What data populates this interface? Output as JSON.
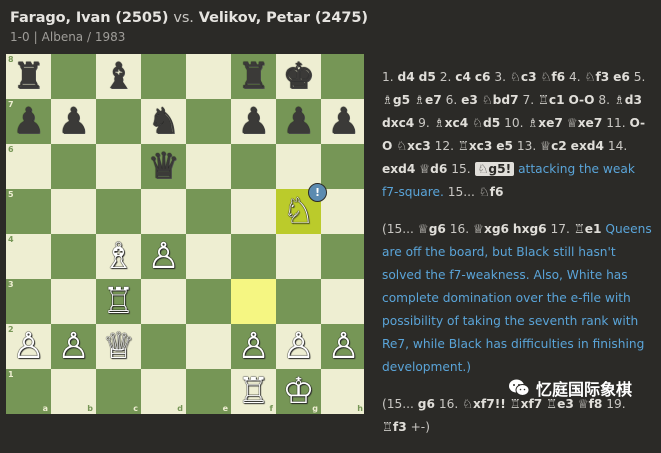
{
  "header": {
    "white": "Farago, Ivan (2505)",
    "vs": "vs.",
    "black": "Velikov, Petar (2475)",
    "result": "1-0",
    "event": "Albena",
    "sep": "/",
    "year": "1983"
  },
  "board": {
    "rank_labels": [
      "8",
      "7",
      "6",
      "5",
      "4",
      "3",
      "2",
      "1"
    ],
    "file_labels": [
      "a",
      "b",
      "c",
      "d",
      "e",
      "f",
      "g",
      "h"
    ],
    "pieces": {
      "a8": "♜",
      "c8": "♝",
      "f8": "♜",
      "g8": "♚",
      "a7": "♟",
      "b7": "♟",
      "d7": "♞",
      "f7": "♟",
      "g7": "♟",
      "h7": "♟",
      "d6": "♛",
      "g5": "♘",
      "c4": "♗",
      "d4": "♙",
      "c3": "♖",
      "a2": "♙",
      "b2": "♙",
      "c2": "♕",
      "f2": "♙",
      "g2": "♙",
      "h2": "♙",
      "f1": "♖",
      "g1": "♔"
    },
    "badge": "!",
    "colors": {
      "light": "#eeeed2",
      "dark": "#769656",
      "highlight": "#f5f682",
      "highlight_dark": "#bbcb2b",
      "badge": "#5c8bb0"
    }
  },
  "notation": {
    "t1": "1.",
    "m1a": "d4",
    "m1b": "d5",
    "t2": "2.",
    "m2a": "c4",
    "m2b": "c6",
    "t3": "3.",
    "m3a": "♘c3",
    "m3b": "♘f6",
    "t4": "4.",
    "m4a": "♘f3",
    "m4b": "e6",
    "t5": "5.",
    "m5a": "♗g5",
    "m5b": "♗e7",
    "t6": "6.",
    "m6a": "e3",
    "m6b": "♘bd7",
    "t7": "7.",
    "m7a": "♖c1",
    "m7b": "O-O",
    "t8": "8.",
    "m8a": "♗d3",
    "m8b": "dxc4",
    "t9": "9.",
    "m9a": "♗xc4",
    "m9b": "♘d5",
    "t10": "10.",
    "m10a": "♗xe7",
    "m10b": "♕xe7",
    "t11": "11.",
    "m11a": "O-O",
    "m11b": "♘xc3",
    "t12": "12.",
    "m12a": "♖xc3",
    "m12b": "e5",
    "t13": "13.",
    "m13a": "♕c2",
    "m13b": "exd4",
    "t14": "14.",
    "m14a": "exd4",
    "m14b": "♕d6",
    "t15": "15.",
    "m15a": "♘g5!",
    "c15": "attacking the weak f7-square.",
    "t15b": "15...",
    "m15b": "♘f6",
    "v_open": "(15...",
    "v1": "♕g6",
    "vt16": "16.",
    "v2": "♕xg6",
    "v3": "hxg6",
    "vt17": "17.",
    "v4": "♖e1",
    "vcomment": "Queens are off the board, but Black still hasn't solved the f7-weakness. Also, White has complete domination over the e-file with possibility of taking the seventh rank with Re7, while Black has difficulties in finishing development.)",
    "w_open": "(15...",
    "w1": "g6",
    "wt16": "16.",
    "w2": "♘xf7!!",
    "w3": "♖xf7",
    "w4": "♖e3",
    "w5": "♕f8",
    "wt19": "19.",
    "w6": "♖f3",
    "w7": "+-)"
  },
  "watermark": {
    "text": "忆庭国际象棋"
  }
}
